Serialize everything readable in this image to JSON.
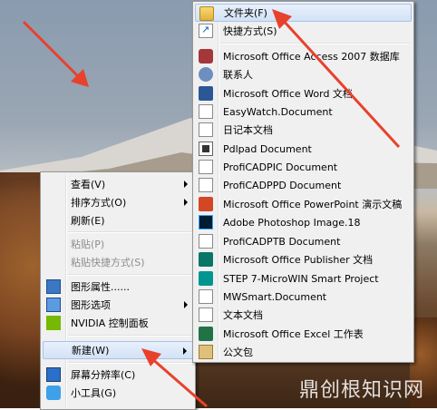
{
  "context_menu": {
    "items": [
      {
        "label": "查看(V)",
        "has_submenu": true,
        "disabled": false
      },
      {
        "label": "排序方式(O)",
        "has_submenu": true,
        "disabled": false
      },
      {
        "label": "刷新(E)",
        "has_submenu": false,
        "disabled": false
      },
      {
        "label": "粘贴(P)",
        "has_submenu": false,
        "disabled": true
      },
      {
        "label": "粘贴快捷方式(S)",
        "has_submenu": false,
        "disabled": true
      },
      {
        "label": "图形属性......",
        "has_submenu": false,
        "disabled": false,
        "icon": "graphics-properties-icon"
      },
      {
        "label": "图形选项",
        "has_submenu": true,
        "disabled": false,
        "icon": "graphics-options-icon"
      },
      {
        "label": "NVIDIA 控制面板",
        "has_submenu": false,
        "disabled": false,
        "icon": "nvidia-icon"
      },
      {
        "label": "新建(W)",
        "has_submenu": true,
        "disabled": false,
        "highlighted": true
      },
      {
        "label": "屏幕分辨率(C)",
        "has_submenu": false,
        "disabled": false,
        "icon": "screen-resolution-icon"
      },
      {
        "label": "小工具(G)",
        "has_submenu": false,
        "disabled": false,
        "icon": "gadgets-icon"
      }
    ]
  },
  "new_submenu": {
    "items": [
      {
        "label": "文件夹(F)",
        "icon": "folder-icon",
        "highlighted": true
      },
      {
        "label": "快捷方式(S)",
        "icon": "shortcut-icon"
      },
      {
        "label": "Microsoft Office Access 2007 数据库",
        "icon": "access-icon"
      },
      {
        "label": "联系人",
        "icon": "contact-icon"
      },
      {
        "label": "Microsoft Office Word 文档",
        "icon": "word-icon"
      },
      {
        "label": "EasyWatch.Document",
        "icon": "document-icon"
      },
      {
        "label": "日记本文档",
        "icon": "journal-icon"
      },
      {
        "label": "Pdlpad Document",
        "icon": "pdlpad-icon"
      },
      {
        "label": "ProfiCADPIC Document",
        "icon": "document-icon"
      },
      {
        "label": "ProfiCADPPD Document",
        "icon": "document-icon"
      },
      {
        "label": "Microsoft Office PowerPoint 演示文稿",
        "icon": "powerpoint-icon"
      },
      {
        "label": "Adobe Photoshop Image.18",
        "icon": "photoshop-icon"
      },
      {
        "label": "ProfiCADPTB Document",
        "icon": "document-icon"
      },
      {
        "label": "Microsoft Office Publisher 文档",
        "icon": "publisher-icon"
      },
      {
        "label": "STEP 7-MicroWIN Smart Project",
        "icon": "step7-icon"
      },
      {
        "label": "MWSmart.Document",
        "icon": "document-icon"
      },
      {
        "label": "文本文档",
        "icon": "text-document-icon"
      },
      {
        "label": "Microsoft Office Excel 工作表",
        "icon": "excel-icon"
      },
      {
        "label": "公文包",
        "icon": "briefcase-icon"
      }
    ]
  },
  "watermark": "鼎创根知识网",
  "colors": {
    "annotation_arrow": "#e8412c",
    "menu_bg": "#f0f0f0",
    "highlight": "#d3e2f6"
  }
}
